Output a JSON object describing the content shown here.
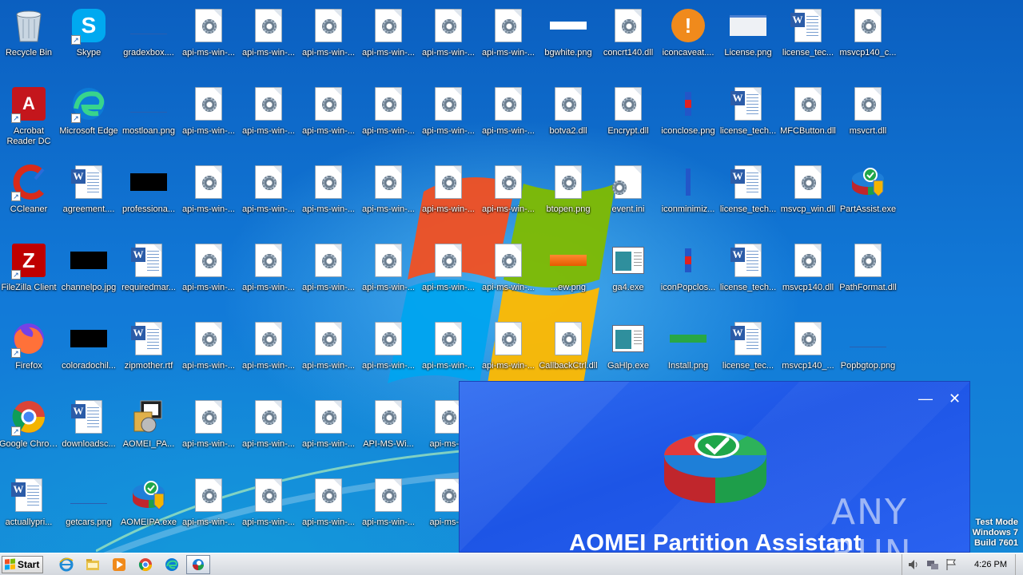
{
  "desktop": {
    "icons": [
      {
        "label": "Recycle Bin",
        "kind": "recycle",
        "col": 0,
        "row": 0
      },
      {
        "label": "Skype",
        "kind": "skype",
        "col": 1,
        "row": 0
      },
      {
        "label": "gradexbox....",
        "kind": "thumb-blue",
        "col": 2,
        "row": 0
      },
      {
        "label": "api-ms-win-...",
        "kind": "dll",
        "col": 3,
        "row": 0
      },
      {
        "label": "api-ms-win-...",
        "kind": "dll",
        "col": 4,
        "row": 0
      },
      {
        "label": "api-ms-win-...",
        "kind": "dll",
        "col": 5,
        "row": 0
      },
      {
        "label": "api-ms-win-...",
        "kind": "dll",
        "col": 6,
        "row": 0
      },
      {
        "label": "api-ms-win-...",
        "kind": "dll",
        "col": 7,
        "row": 0
      },
      {
        "label": "api-ms-win-...",
        "kind": "dll",
        "col": 8,
        "row": 0
      },
      {
        "label": "bgwhite.png",
        "kind": "thumb-white",
        "col": 9,
        "row": 0
      },
      {
        "label": "concrt140.dll",
        "kind": "dll",
        "col": 10,
        "row": 0
      },
      {
        "label": "iconcaveat....",
        "kind": "warning",
        "col": 11,
        "row": 0
      },
      {
        "label": "License.png",
        "kind": "thumb-grey",
        "col": 12,
        "row": 0
      },
      {
        "label": "license_tec...",
        "kind": "doc",
        "col": 13,
        "row": 0
      },
      {
        "label": "msvcp140_c...",
        "kind": "dll",
        "col": 14,
        "row": 0
      },
      {
        "label": "Acrobat Reader DC",
        "kind": "acrobat",
        "col": 0,
        "row": 1
      },
      {
        "label": "Microsoft Edge",
        "kind": "edge",
        "col": 1,
        "row": 1
      },
      {
        "label": "mostloan.png",
        "kind": "thumb-blue",
        "col": 2,
        "row": 1
      },
      {
        "label": "api-ms-win-...",
        "kind": "dll",
        "col": 3,
        "row": 1
      },
      {
        "label": "api-ms-win-...",
        "kind": "dll",
        "col": 4,
        "row": 1
      },
      {
        "label": "api-ms-win-...",
        "kind": "dll",
        "col": 5,
        "row": 1
      },
      {
        "label": "api-ms-win-...",
        "kind": "dll",
        "col": 6,
        "row": 1
      },
      {
        "label": "api-ms-win-...",
        "kind": "dll",
        "col": 7,
        "row": 1
      },
      {
        "label": "api-ms-win-...",
        "kind": "dll",
        "col": 8,
        "row": 1
      },
      {
        "label": "botva2.dll",
        "kind": "dll",
        "col": 9,
        "row": 1
      },
      {
        "label": "Encrypt.dll",
        "kind": "dll",
        "col": 10,
        "row": 1
      },
      {
        "label": "iconclose.png",
        "kind": "redbar",
        "col": 11,
        "row": 1
      },
      {
        "label": "license_tech...",
        "kind": "doc",
        "col": 12,
        "row": 1
      },
      {
        "label": "MFCButton.dll",
        "kind": "dll",
        "col": 13,
        "row": 1
      },
      {
        "label": "msvcrt.dll",
        "kind": "dll",
        "col": 14,
        "row": 1
      },
      {
        "label": "CCleaner",
        "kind": "ccleaner",
        "col": 0,
        "row": 2
      },
      {
        "label": "agreement....",
        "kind": "doc",
        "col": 1,
        "row": 2
      },
      {
        "label": "professiona...",
        "kind": "thumb-black",
        "col": 2,
        "row": 2
      },
      {
        "label": "api-ms-win-...",
        "kind": "dll",
        "col": 3,
        "row": 2
      },
      {
        "label": "api-ms-win-...",
        "kind": "dll",
        "col": 4,
        "row": 2
      },
      {
        "label": "api-ms-win-...",
        "kind": "dll",
        "col": 5,
        "row": 2
      },
      {
        "label": "api-ms-win-...",
        "kind": "dll",
        "col": 6,
        "row": 2
      },
      {
        "label": "api-ms-win-...",
        "kind": "dll",
        "col": 7,
        "row": 2
      },
      {
        "label": "api-ms-win-...",
        "kind": "dll",
        "col": 8,
        "row": 2
      },
      {
        "label": "btopen.png",
        "kind": "dll",
        "col": 9,
        "row": 2
      },
      {
        "label": "event.ini",
        "kind": "ini",
        "col": 10,
        "row": 2
      },
      {
        "label": "iconminimiz...",
        "kind": "bluebar",
        "col": 11,
        "row": 2
      },
      {
        "label": "license_tech...",
        "kind": "doc",
        "col": 12,
        "row": 2
      },
      {
        "label": "msvcp_win.dll",
        "kind": "dll",
        "col": 13,
        "row": 2
      },
      {
        "label": "PartAssist.exe",
        "kind": "partassist",
        "col": 14,
        "row": 2
      },
      {
        "label": "FileZilla Client",
        "kind": "filezilla",
        "col": 0,
        "row": 3
      },
      {
        "label": "channelpo.jpg",
        "kind": "thumb-black",
        "col": 1,
        "row": 3
      },
      {
        "label": "requiredmar...",
        "kind": "doc",
        "col": 2,
        "row": 3
      },
      {
        "label": "api-ms-win-...",
        "kind": "dll",
        "col": 3,
        "row": 3
      },
      {
        "label": "api-ms-win-...",
        "kind": "dll",
        "col": 4,
        "row": 3
      },
      {
        "label": "api-ms-win-...",
        "kind": "dll",
        "col": 5,
        "row": 3
      },
      {
        "label": "api-ms-win-...",
        "kind": "dll",
        "col": 6,
        "row": 3
      },
      {
        "label": "api-ms-win-...",
        "kind": "dll",
        "col": 7,
        "row": 3
      },
      {
        "label": "api-ms-win-...",
        "kind": "dll",
        "col": 8,
        "row": 3
      },
      {
        "label": "...ew.png",
        "kind": "thumb-orange",
        "col": 9,
        "row": 3
      },
      {
        "label": "ga4.exe",
        "kind": "window",
        "col": 10,
        "row": 3
      },
      {
        "label": "iconPopclos...",
        "kind": "redbar",
        "col": 11,
        "row": 3
      },
      {
        "label": "license_tech...",
        "kind": "doc",
        "col": 12,
        "row": 3
      },
      {
        "label": "msvcp140.dll",
        "kind": "dll",
        "col": 13,
        "row": 3
      },
      {
        "label": "PathFormat.dll",
        "kind": "dll",
        "col": 14,
        "row": 3
      },
      {
        "label": "Firefox",
        "kind": "firefox",
        "col": 0,
        "row": 4
      },
      {
        "label": "coloradochil...",
        "kind": "thumb-black",
        "col": 1,
        "row": 4
      },
      {
        "label": "zipmother.rtf",
        "kind": "doc",
        "col": 2,
        "row": 4
      },
      {
        "label": "api-ms-win-...",
        "kind": "dll",
        "col": 3,
        "row": 4
      },
      {
        "label": "api-ms-win-...",
        "kind": "dll",
        "col": 4,
        "row": 4
      },
      {
        "label": "api-ms-win-...",
        "kind": "dll",
        "col": 5,
        "row": 4
      },
      {
        "label": "api-ms-win-...",
        "kind": "dll",
        "col": 6,
        "row": 4
      },
      {
        "label": "api-ms-win-...",
        "kind": "dll",
        "col": 7,
        "row": 4
      },
      {
        "label": "api-ms-win-...",
        "kind": "dll",
        "col": 8,
        "row": 4
      },
      {
        "label": "CallbackCtrl.dll",
        "kind": "dll",
        "col": 9,
        "row": 4
      },
      {
        "label": "GaHlp.exe",
        "kind": "window",
        "col": 10,
        "row": 4
      },
      {
        "label": "Install.png",
        "kind": "thumb-green",
        "col": 11,
        "row": 4
      },
      {
        "label": "license_tec...",
        "kind": "doc",
        "col": 12,
        "row": 4
      },
      {
        "label": "msvcp140_...",
        "kind": "dll",
        "col": 13,
        "row": 4
      },
      {
        "label": "Popbgtop.png",
        "kind": "thumb-blue",
        "col": 14,
        "row": 4
      },
      {
        "label": "Google Chrome",
        "kind": "chrome",
        "col": 0,
        "row": 5
      },
      {
        "label": "downloadsc...",
        "kind": "doc",
        "col": 1,
        "row": 5
      },
      {
        "label": "AOMEI_PA...",
        "kind": "installer",
        "col": 2,
        "row": 5
      },
      {
        "label": "api-ms-win-...",
        "kind": "dll",
        "col": 3,
        "row": 5
      },
      {
        "label": "api-ms-win-...",
        "kind": "dll",
        "col": 4,
        "row": 5
      },
      {
        "label": "api-ms-win-...",
        "kind": "dll",
        "col": 5,
        "row": 5
      },
      {
        "label": "API-MS-Wi...",
        "kind": "dll",
        "col": 6,
        "row": 5
      },
      {
        "label": "api-ms-wi",
        "kind": "dll",
        "col": 7,
        "row": 5
      },
      {
        "label": "actuallypri...",
        "kind": "doc",
        "col": 0,
        "row": 6
      },
      {
        "label": "getcars.png",
        "kind": "thumb-blue",
        "col": 1,
        "row": 6
      },
      {
        "label": "AOMEIPA.exe",
        "kind": "partassist",
        "col": 2,
        "row": 6
      },
      {
        "label": "api-ms-win-...",
        "kind": "dll",
        "col": 3,
        "row": 6
      },
      {
        "label": "api-ms-win-...",
        "kind": "dll",
        "col": 4,
        "row": 6
      },
      {
        "label": "api-ms-win-...",
        "kind": "dll",
        "col": 5,
        "row": 6
      },
      {
        "label": "api-ms-win-...",
        "kind": "dll",
        "col": 6,
        "row": 6
      },
      {
        "label": "api-ms-wi",
        "kind": "dll",
        "col": 7,
        "row": 6
      }
    ]
  },
  "aomei_window": {
    "title": "AOMEI Partition Assistant",
    "minimize_glyph": "—",
    "close_glyph": "✕"
  },
  "watermark": {
    "text": "ANY RUN"
  },
  "test_mode": {
    "line1": "Test Mode",
    "line2": "Windows 7",
    "line3": "Build 7601"
  },
  "taskbar": {
    "start_label": "Start",
    "clock": "4:26 PM",
    "pinned": [
      "ie-icon",
      "explorer-icon",
      "media-player-icon",
      "chrome-icon",
      "edge-icon",
      "aomei-icon"
    ]
  }
}
